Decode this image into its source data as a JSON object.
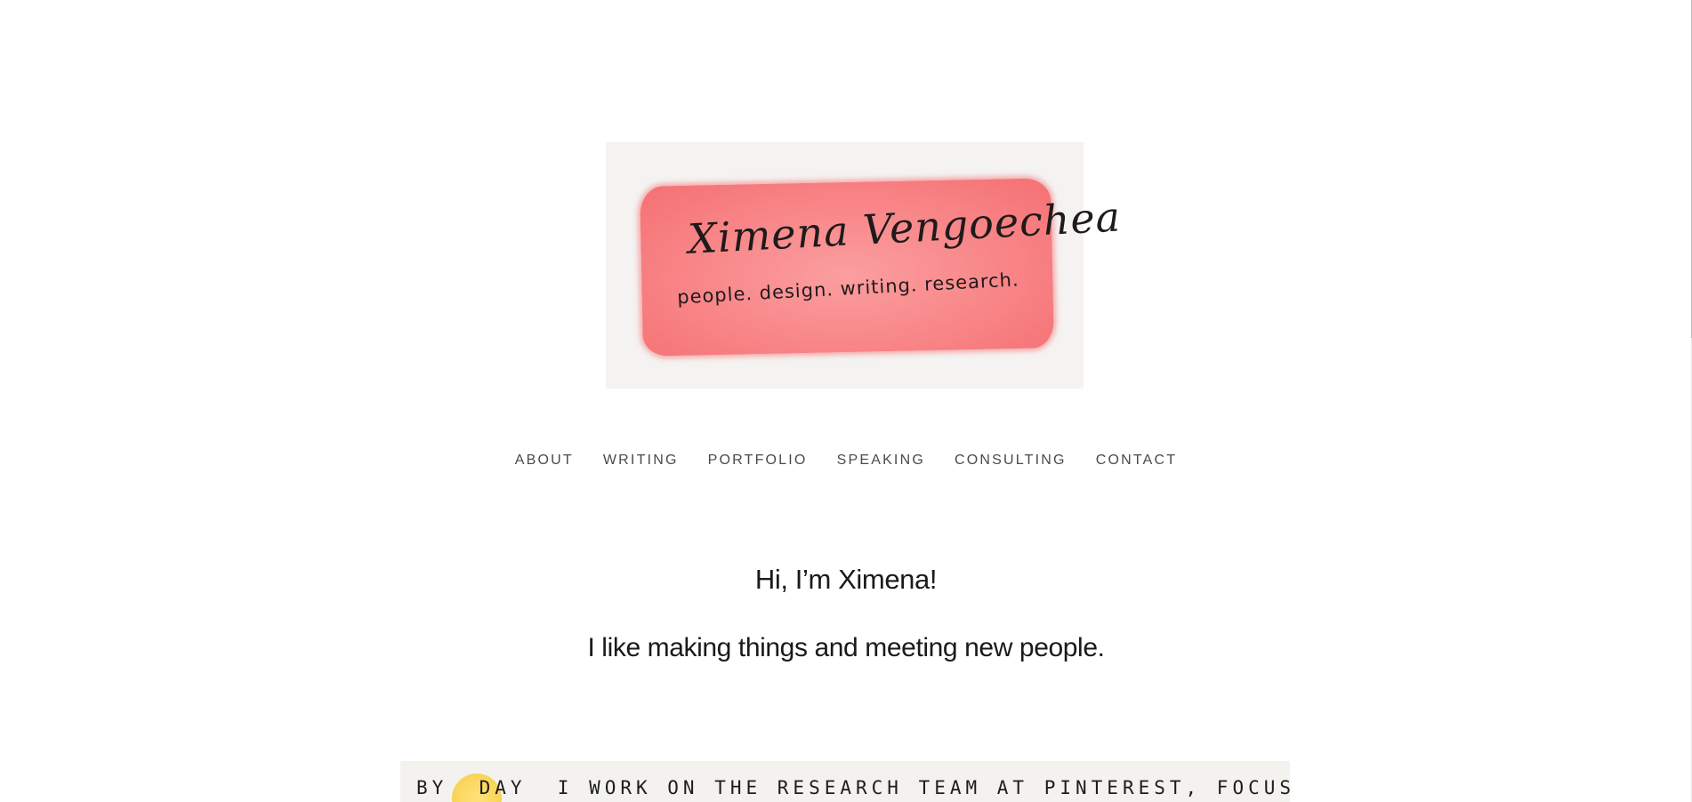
{
  "logo": {
    "name": "Ximena Vengoechea",
    "tagline": "people. design. writing. research."
  },
  "nav": {
    "items": [
      {
        "label": "ABOUT"
      },
      {
        "label": "WRITING"
      },
      {
        "label": "PORTFOLIO"
      },
      {
        "label": "SPEAKING"
      },
      {
        "label": "CONSULTING"
      },
      {
        "label": "CONTACT"
      }
    ]
  },
  "intro": {
    "greeting": "Hi, I’m Ximena!",
    "subline": "I like making things and meeting new people."
  },
  "story": {
    "text": "BY  DAY  I WORK ON THE RESEARCH TEAM AT PINTEREST, FOCUSING ON OUR"
  },
  "colors": {
    "accent": "#f88587",
    "text": "#1a1a1a",
    "nav": "#4a4a4a",
    "banner_bg": "#f4f3f1"
  }
}
